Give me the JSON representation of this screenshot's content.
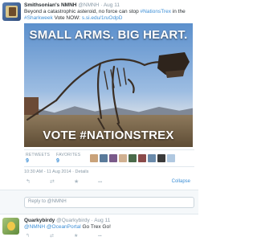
{
  "tweet": {
    "name": "Smithsonian's NMNH",
    "handle": "@NMNH",
    "dot": "·",
    "time": "Aug 11",
    "text_prefix": "Beyond a catastrophic asteroid, no force can stop",
    "hashtag_nationstrex": "#NationsTrex",
    "text_mid": "in the",
    "hashtag_sharkweek": "#Sharkweek",
    "text_vote": "Vote NOW:",
    "link": "s.si.edu/1ruOdpD",
    "media": {
      "headline_top": "SMALL ARMS. BIG HEART.",
      "headline_bottom": "VOTE #NATIONSTREX"
    },
    "stats": {
      "retweets_label": "RETWEETS",
      "retweets_count": "9",
      "favorites_label": "FAVORITES",
      "favorites_count": "9",
      "favoriter_colors": [
        "#c9a27a",
        "#5a7a9a",
        "#7a5a8a",
        "#d0b090",
        "#4a6a4a",
        "#8a4a4a",
        "#6a8aaa",
        "#3a3a3a",
        "#b0c8e0"
      ]
    },
    "meta": {
      "timestamp": "10:30 AM - 11 Aug 2014",
      "details": "Details"
    },
    "actions": {
      "reply_icon": "reply-arrow",
      "retweet_icon": "retweet-arrows",
      "favorite_icon": "star",
      "more_icon": "ellipsis",
      "reply_glyph": "↰",
      "retweet_glyph": "⇄",
      "favorite_glyph": "★",
      "more_glyph": "•••",
      "collapse_label": "Collapse"
    }
  },
  "reply_box": {
    "placeholder": "Reply to @NMNH"
  },
  "reply": {
    "name": "Quarkybirdy",
    "handle": "@Quarkybirdy",
    "dot": "·",
    "time": "Aug 11",
    "mention1": "@NMNH",
    "mention2": "@OceanPortal",
    "text": "Go Trex Go!"
  }
}
